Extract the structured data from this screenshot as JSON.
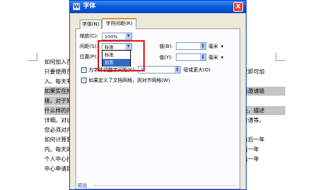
{
  "document": {
    "left_lines": [
      {
        "text": "如何加入百",
        "shaded": false
      },
      {
        "text": "只要使用百",
        "shaded": false
      },
      {
        "text": "入。每天有",
        "shaded": false
      },
      {
        "text": "如果实在抢",
        "shaded": true
      },
      {
        "text": "接。对于知",
        "shaded": true
      },
      {
        "text": "什么样的内",
        "shaded": true
      },
      {
        "text": "详细。对读",
        "shaded": false
      },
      {
        "text": "您必须对内",
        "shaded": false
      },
      {
        "text": "如何计算我",
        "shaded": false
      },
      {
        "text": "内。每天的",
        "shaded": false
      },
      {
        "text": "个人中心找",
        "shaded": false
      },
      {
        "text": "中心申请提",
        "shaded": false
      }
    ],
    "right_lines": [
      {
        "text": "导议即可加",
        "shaded": false
      },
      {
        "text": "导与邀请链",
        "shaded": true
      },
      {
        "text": "相关，描述",
        "shaded": true
      },
      {
        "text": "、食谱等。",
        "shaded": false
      },
      {
        "text": "发布后一年",
        "shaded": false
      },
      {
        "text": "可后一年",
        "shaded": false
      },
      {
        "text": "可后一年",
        "shaded": false
      }
    ]
  },
  "dialog": {
    "title": "字体",
    "close_label": "X",
    "tabs": [
      {
        "label": "字体(N)",
        "active": false
      },
      {
        "label": "字符间距(R)",
        "active": true
      }
    ],
    "scale": {
      "label": "缩放(C):",
      "value": "100%"
    },
    "spacing": {
      "label": "间距(S):",
      "value": "标准",
      "amount_label": "值(B):",
      "amount_value": "",
      "unit": "毫米"
    },
    "position": {
      "label": "位置(P):",
      "amount_label": "值(Y):",
      "amount_value": "",
      "unit": "毫米"
    },
    "dropdown_options": [
      {
        "label": "标准",
        "selected": false
      },
      {
        "label": "加宽",
        "selected": true
      }
    ],
    "kerning": {
      "checked": true,
      "label": "为字体调整字间距(K):",
      "value": "1",
      "suffix": "磅或更大(O)"
    },
    "grid": {
      "checked": true,
      "label": "如果定义了文档网格，则对齐网格(W)"
    },
    "preview_label": "预览"
  }
}
